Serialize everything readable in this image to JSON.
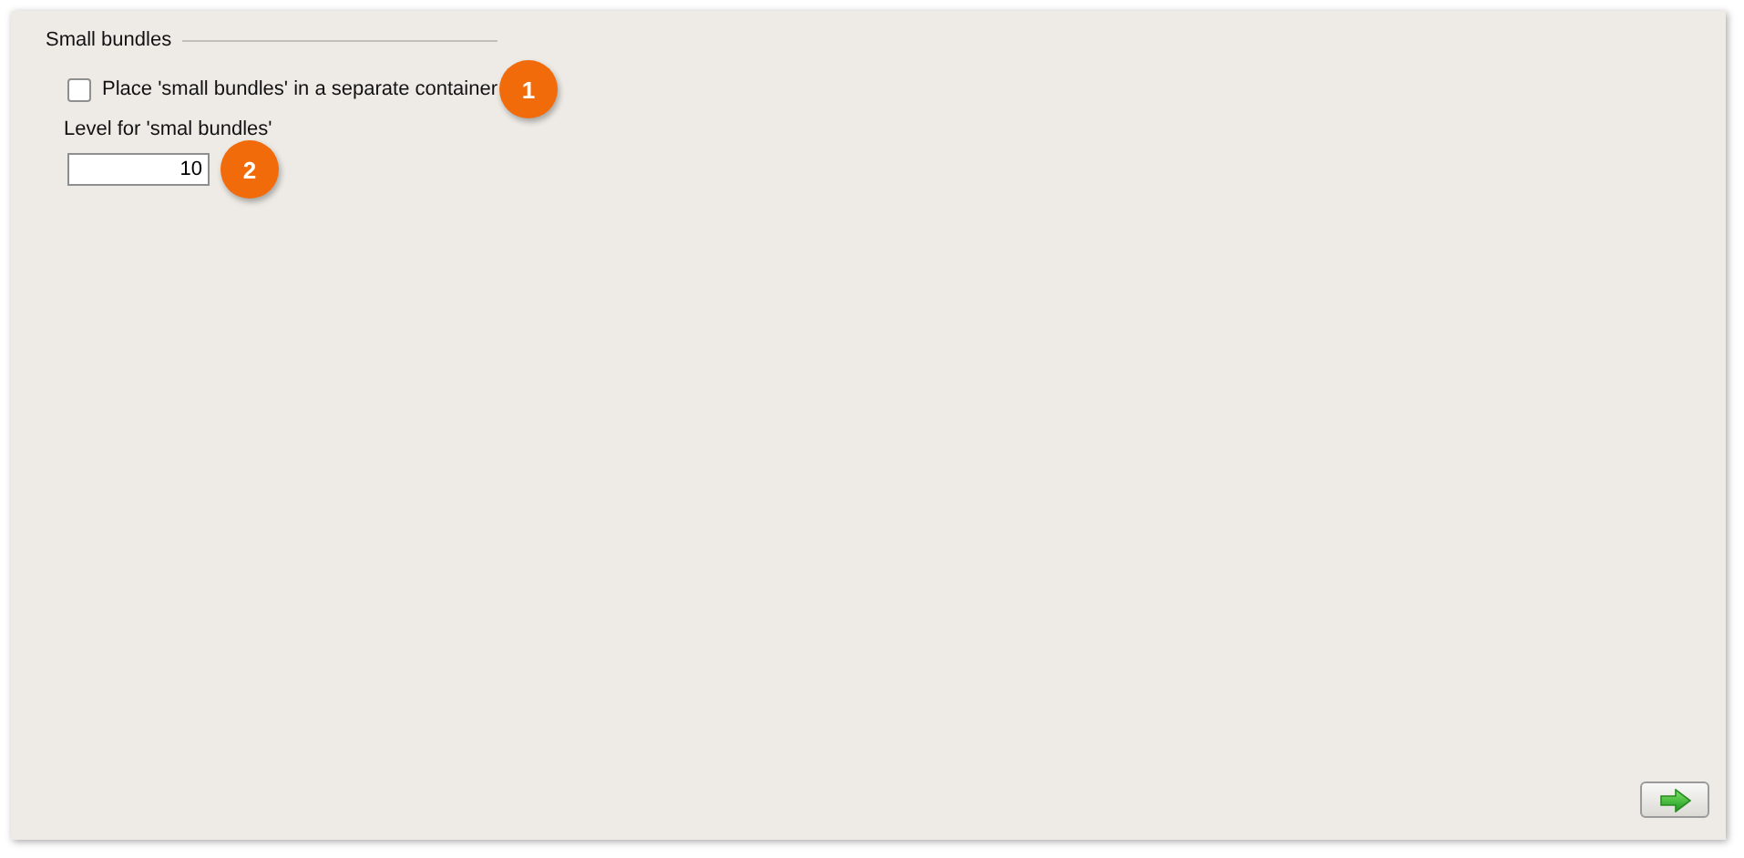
{
  "group": {
    "title": "Small bundles"
  },
  "checkbox": {
    "label": "Place 'small bundles' in a separate container",
    "checked": false,
    "callout": "1"
  },
  "level_field": {
    "label": "Level for 'smal bundles'",
    "value": "10",
    "callout": "2"
  }
}
